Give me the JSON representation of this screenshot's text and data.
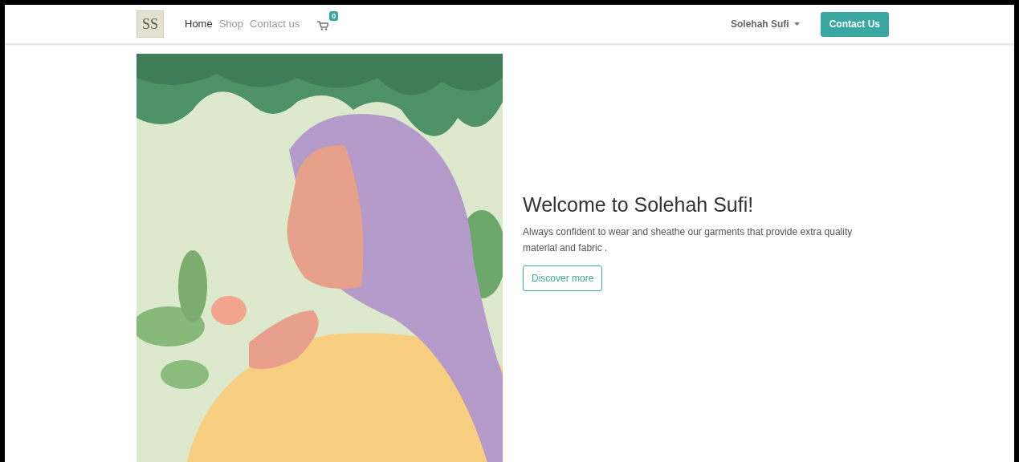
{
  "navbar": {
    "logo": "SS",
    "links": [
      {
        "label": "Home",
        "selected": true
      },
      {
        "label": "Shop",
        "selected": false
      },
      {
        "label": "Contact us",
        "selected": false
      }
    ],
    "cart_count": "0",
    "user_menu": "Solehah Sufi",
    "cta": "Contact Us"
  },
  "hero": {
    "title": "Welcome to Solehah Sufi!",
    "text": "Always confident to wear and sheathe our garments that provide extra quality material and fabric .",
    "button": "Discover more"
  }
}
